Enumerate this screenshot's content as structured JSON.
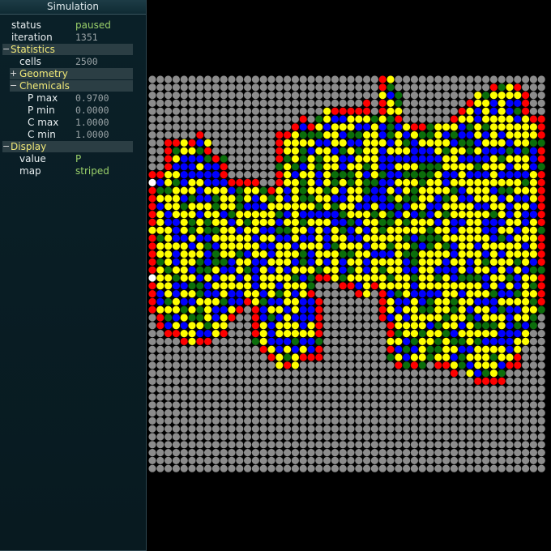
{
  "panel": {
    "title": "Simulation",
    "status": {
      "label": "status",
      "value": "paused"
    },
    "iteration": {
      "label": "iteration",
      "value": "1351"
    },
    "statistics": {
      "title": "Statistics",
      "toggle": "−",
      "cells": {
        "label": "cells",
        "value": "2500"
      },
      "geometry": {
        "title": "Geometry",
        "toggle": "+"
      },
      "chemicals": {
        "title": "Chemicals",
        "toggle": "−",
        "p_max": {
          "label": "P max",
          "value": "0.9700"
        },
        "p_min": {
          "label": "P min",
          "value": "0.0000"
        },
        "c_max": {
          "label": "C max",
          "value": "1.0000"
        },
        "c_min": {
          "label": "C min",
          "value": "1.0000"
        }
      }
    },
    "display": {
      "title": "Display",
      "toggle": "−",
      "value": {
        "label": "value",
        "value": "P"
      },
      "map": {
        "label": "map",
        "value": "striped"
      }
    }
  },
  "grid": {
    "columns": 50,
    "rows": 50,
    "colors": {
      "empty": "#8c8c8c",
      "red": "#ff0000",
      "yellow": "#ffff00",
      "blue": "#0000ff",
      "green": "#0b6e0b",
      "white": "#ffffff"
    }
  }
}
